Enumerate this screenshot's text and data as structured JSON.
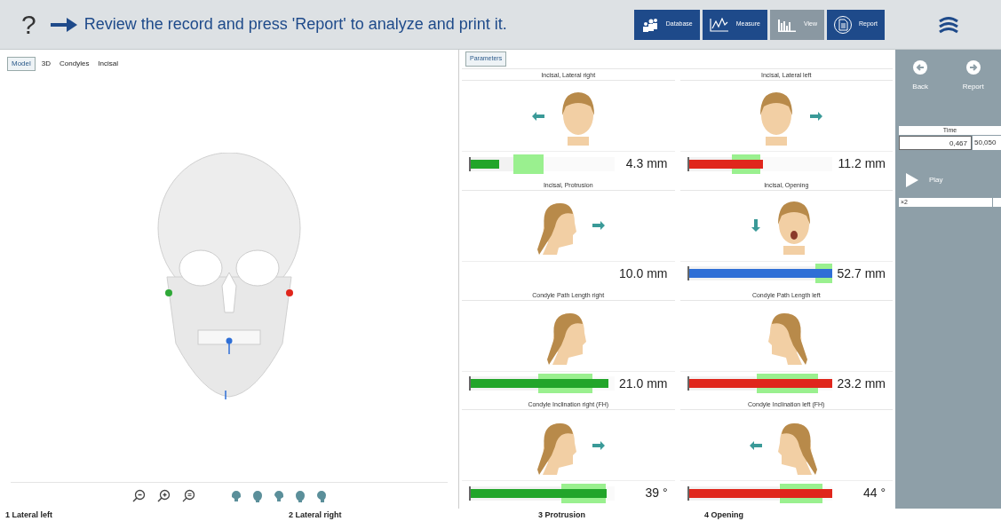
{
  "toolbar": {
    "help": "?",
    "instruction": "Review the record and press 'Report' to analyze and print it.",
    "buttons": [
      {
        "label": "Database",
        "selected": false
      },
      {
        "label": "Measure",
        "selected": false
      },
      {
        "label": "View",
        "selected": true
      },
      {
        "label": "Report",
        "selected": false
      }
    ]
  },
  "model_panel": {
    "tabs": [
      {
        "label": "Model",
        "selected": true
      },
      {
        "label": "3D",
        "selected": false
      },
      {
        "label": "Condyles",
        "selected": false
      },
      {
        "label": "Incisal",
        "selected": false
      }
    ]
  },
  "parameters_panel": {
    "tab": {
      "label": "Parameters",
      "selected": true
    },
    "params": [
      {
        "title": "Incisal, Lateral right",
        "value": "4.3 mm",
        "color": "#22a52a",
        "fill": {
          "level": 0.2
        },
        "norm_start": {
          "level": 0.3
        },
        "norm_end": {
          "level": 0.51
        }
      },
      {
        "title": "Incisal, Lateral left",
        "value": "11.2 mm",
        "color": "#e0261c",
        "fill": {
          "level": 0.52
        },
        "norm_start": {
          "level": 0.3
        },
        "norm_end": {
          "level": 0.5
        }
      },
      {
        "title": "Incisal, Protrusion",
        "value": "10.0 mm"
      },
      {
        "title": "Incisal, Opening",
        "value": "52.7 mm",
        "color": "#2f6fd6",
        "fill": {
          "level": 1
        },
        "norm_start": {
          "level": 0.88
        },
        "norm_end": {
          "level": 1
        }
      },
      {
        "title": "Condyle Path Length right",
        "value": "21.0 mm",
        "color": "#22a52a",
        "fill": {
          "level": 0.96
        },
        "norm_start": {
          "level": 0.47
        },
        "norm_end": {
          "level": 0.85
        }
      },
      {
        "title": "Condyle Path Length left",
        "value": "23.2 mm",
        "color": "#e0261c",
        "fill": {
          "level": 1
        },
        "norm_start": {
          "level": 0.47
        },
        "norm_end": {
          "level": 0.9
        }
      },
      {
        "title": "Condyle Inclination right (FH)",
        "value": "39 °",
        "color": "#22a52a",
        "fill": {
          "level": 0.95
        },
        "norm_start": {
          "level": 0.63
        },
        "norm_end": {
          "level": 0.94
        }
      },
      {
        "title": "Condyle Inclination left (FH)",
        "value": "44 °",
        "color": "#e0261c",
        "fill": {
          "level": 1
        },
        "norm_start": {
          "level": 0.63
        },
        "norm_end": {
          "level": 0.93
        }
      }
    ]
  },
  "sidebar": {
    "back": "Back",
    "report": "Report",
    "time_label": "Time",
    "time_value": "0,467",
    "time_total": "50,050",
    "play": "Play",
    "speed": "×2"
  },
  "recordings": [
    "1 Lateral left",
    "2 Lateral right",
    "3 Protrusion",
    "4 Opening"
  ]
}
